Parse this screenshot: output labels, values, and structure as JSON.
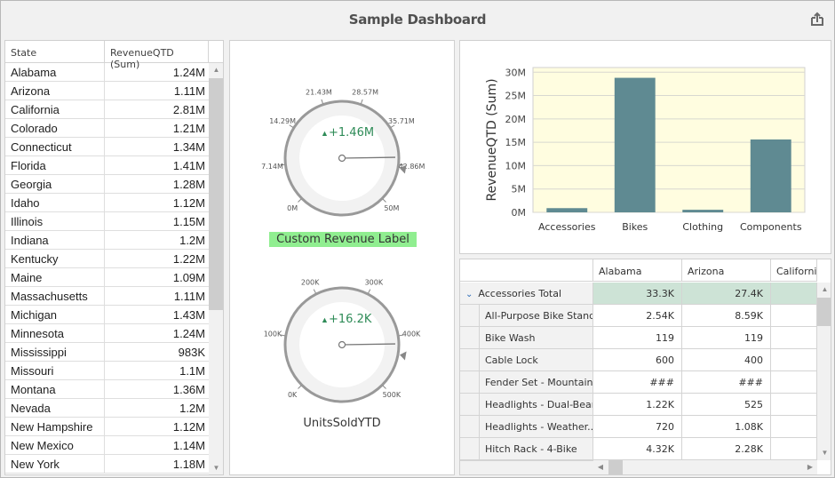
{
  "header": {
    "title": "Sample Dashboard",
    "export_icon": "export-icon"
  },
  "state_grid": {
    "columns": [
      "State",
      "RevenueQTD (Sum)"
    ],
    "rows": [
      {
        "state": "Alabama",
        "value": "1.24M"
      },
      {
        "state": "Arizona",
        "value": "1.11M"
      },
      {
        "state": "California",
        "value": "2.81M"
      },
      {
        "state": "Colorado",
        "value": "1.21M"
      },
      {
        "state": "Connecticut",
        "value": "1.34M"
      },
      {
        "state": "Florida",
        "value": "1.41M"
      },
      {
        "state": "Georgia",
        "value": "1.28M"
      },
      {
        "state": "Idaho",
        "value": "1.12M"
      },
      {
        "state": "Illinois",
        "value": "1.15M"
      },
      {
        "state": "Indiana",
        "value": "1.2M"
      },
      {
        "state": "Kentucky",
        "value": "1.22M"
      },
      {
        "state": "Maine",
        "value": "1.09M"
      },
      {
        "state": "Massachusetts",
        "value": "1.11M"
      },
      {
        "state": "Michigan",
        "value": "1.43M"
      },
      {
        "state": "Minnesota",
        "value": "1.24M"
      },
      {
        "state": "Mississippi",
        "value": "983K"
      },
      {
        "state": "Missouri",
        "value": "1.1M"
      },
      {
        "state": "Montana",
        "value": "1.36M"
      },
      {
        "state": "Nevada",
        "value": "1.2M"
      },
      {
        "state": "New Hampshire",
        "value": "1.12M"
      },
      {
        "state": "New Mexico",
        "value": "1.14M"
      },
      {
        "state": "New York",
        "value": "1.18M"
      }
    ],
    "scroll_up_glyph": "▲",
    "scroll_down_glyph": "▼"
  },
  "gauges": [
    {
      "id": "revenue",
      "delta_text": "+1.46M",
      "delta_glyph": "▲",
      "ticks": [
        "0M",
        "7.14M",
        "14.29M",
        "21.43M",
        "28.57M",
        "35.71M",
        "42.86M",
        "50M"
      ],
      "min": 0,
      "max": 50,
      "value_fraction": 0.83,
      "target_fraction": 0.87,
      "caption": "Custom Revenue Label",
      "caption_bg": "#90ee90"
    },
    {
      "id": "units",
      "delta_text": "+16.2K",
      "delta_glyph": "▲",
      "ticks": [
        "0K",
        "100K",
        "200K",
        "300K",
        "400K",
        "500K"
      ],
      "min": 0,
      "max": 500,
      "value_fraction": 0.83,
      "target_fraction": 0.87,
      "caption": "UnitsSoldYTD"
    }
  ],
  "colors": {
    "delta_positive": "#2e8b57",
    "bar": "#5f8a92",
    "chart_bg": "#fffde0",
    "total_row": "#cde3d6"
  },
  "chart_data": {
    "type": "bar",
    "categories": [
      "Accessories",
      "Bikes",
      "Clothing",
      "Components"
    ],
    "values": [
      0.9,
      28.8,
      0.55,
      15.6
    ],
    "unit": "M",
    "title": "",
    "xlabel": "",
    "ylabel": "RevenueQTD (Sum)",
    "ylim": [
      0,
      31
    ],
    "yticks": [
      0,
      5,
      10,
      15,
      20,
      25,
      30
    ],
    "ytick_labels": [
      "0M",
      "5M",
      "10M",
      "15M",
      "20M",
      "25M",
      "30M"
    ],
    "grid": true,
    "legend": "none"
  },
  "pivot": {
    "columns": [
      "Alabama",
      "Arizona",
      "California"
    ],
    "rows": [
      {
        "label": "Accessories Total",
        "values": [
          "33.3K",
          "27.4K",
          ""
        ],
        "total": true,
        "expand_glyph": "⌄"
      },
      {
        "label": "All-Purpose Bike Stand",
        "values": [
          "2.54K",
          "8.59K",
          ""
        ]
      },
      {
        "label": "Bike Wash",
        "values": [
          "119",
          "119",
          ""
        ]
      },
      {
        "label": "Cable Lock",
        "values": [
          "600",
          "400",
          ""
        ]
      },
      {
        "label": "Fender Set - Mountain",
        "values": [
          "###",
          "###",
          ""
        ]
      },
      {
        "label": "Headlights - Dual-Beam",
        "values": [
          "1.22K",
          "525",
          ""
        ]
      },
      {
        "label": "Headlights - Weather...",
        "values": [
          "720",
          "1.08K",
          ""
        ]
      },
      {
        "label": "Hitch Rack - 4-Bike",
        "values": [
          "4.32K",
          "2.28K",
          ""
        ]
      }
    ],
    "scroll_left_glyph": "◀",
    "scroll_right_glyph": "▶"
  }
}
